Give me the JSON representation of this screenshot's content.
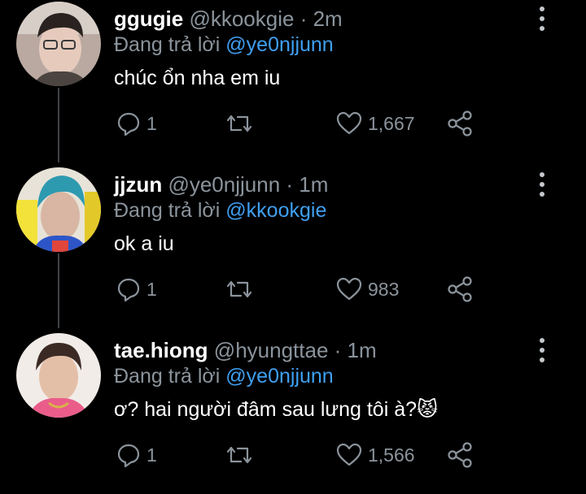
{
  "tweets": [
    {
      "name": "ggugie",
      "handle": "@kkookgie",
      "time": "2m",
      "reply_prefix": "Đang trả lời",
      "reply_to": "@ye0njjunn",
      "text": "chúc ổn nha em iu",
      "replies": "1",
      "likes": "1,667"
    },
    {
      "name": "jjzun",
      "handle": "@ye0njjunn",
      "time": "1m",
      "reply_prefix": "Đang trả lời",
      "reply_to": "@kkookgie",
      "text": "ok a iu",
      "replies": "1",
      "likes": "983"
    },
    {
      "name": "tae.hiong",
      "handle": "@hyungttae",
      "time": "1m",
      "reply_prefix": "Đang trả lời",
      "reply_to": "@ye0njjunn",
      "text": "ơ? hai người đâm sau lưng tôi à?",
      "emoji": "😾",
      "replies": "1",
      "likes": "1,566"
    }
  ],
  "separator": " · ",
  "colors": {
    "background": "#000000",
    "secondary_text": "#8b949c",
    "link": "#3f9ff0",
    "thread_line": "#3d4146"
  },
  "icons": [
    "reply-icon",
    "retweet-icon",
    "like-icon",
    "share-icon",
    "more-options-icon"
  ]
}
